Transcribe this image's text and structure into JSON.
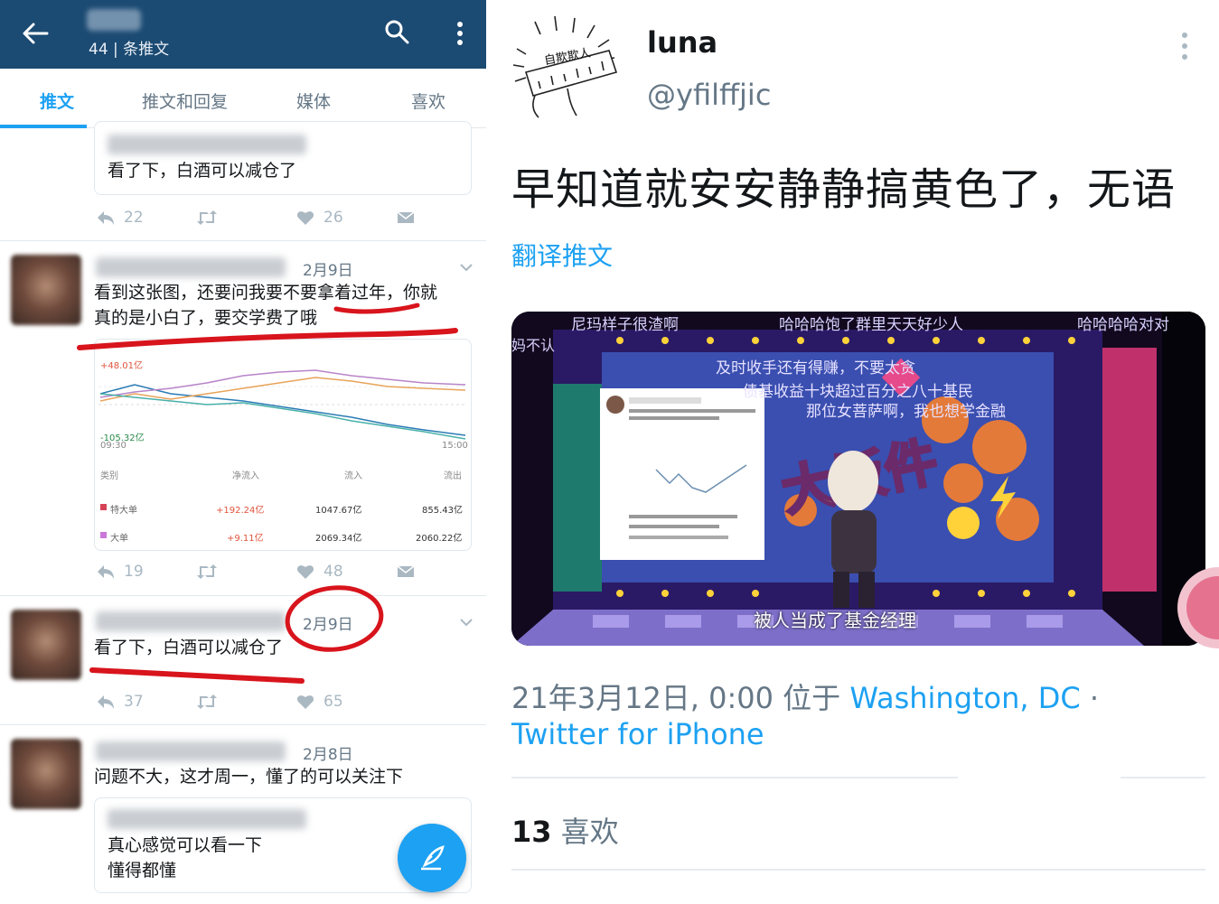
{
  "left": {
    "header": {
      "count_label": "44 | 条推文"
    },
    "tabs": [
      "推文",
      "推文和回复",
      "媒体",
      "喜欢"
    ],
    "posts": [
      {
        "text": "看了下，白酒可以减仓了",
        "replies": "22",
        "likes": "26"
      },
      {
        "date": "2月9日",
        "text_line1": "看到这张图，还要问我要不要拿着过年，你就",
        "text_line2": "真的是小白了，要交学费了哦",
        "chart": {
          "top_label": "+48.01亿",
          "bottom_label": "-105.32亿",
          "time_start": "09:30",
          "time_end": "15:00",
          "headers": [
            "类别",
            "净流入",
            "流入",
            "流出"
          ],
          "rows": [
            [
              "特大单",
              "+192.24亿",
              "1047.67亿",
              "855.43亿"
            ],
            [
              "大单",
              "+9.11亿",
              "2069.34亿",
              "2060.22亿"
            ]
          ]
        },
        "replies": "19",
        "likes": "48"
      },
      {
        "date": "2月9日",
        "text": "看了下，白酒可以减仓了",
        "replies": "37",
        "likes": "65"
      },
      {
        "date": "2月8日",
        "text": "问题不大，这才周一，懂了的可以关注下",
        "quote_line1": "真心感觉可以看一下",
        "quote_line2": "懂得都懂"
      }
    ]
  },
  "right": {
    "logo_text": "自欺欺人",
    "name": "luna",
    "handle": "@yfilffjic",
    "tweet_text": "早知道就安安静静搞黄色了，无语",
    "translate": "翻译推文",
    "media_captions": {
      "top_left": "尼玛样子很渣啊",
      "top_mid": "哈哈哈饱了群里天天好少人",
      "top_right": "哈哈哈哈对对",
      "side_left": "妈不认",
      "line1": "及时收手还有得赚，不要太贪",
      "line2": "债基收益十块超过百分之八十基民",
      "line3": "那位女菩萨啊，我也想学金融",
      "bottom": "被人当成了基金经理",
      "big_word": "大饭件"
    },
    "meta_time": "21年3月12日, 0:00 位于 ",
    "meta_location": "Washington, DC",
    "meta_dot": " ·",
    "meta_source": "Twitter for iPhone",
    "likes_count": "13",
    "likes_label": "喜欢"
  },
  "colors": {
    "accent": "#1da1f2",
    "header": "#1b4a72",
    "annotation": "#d8141c"
  }
}
